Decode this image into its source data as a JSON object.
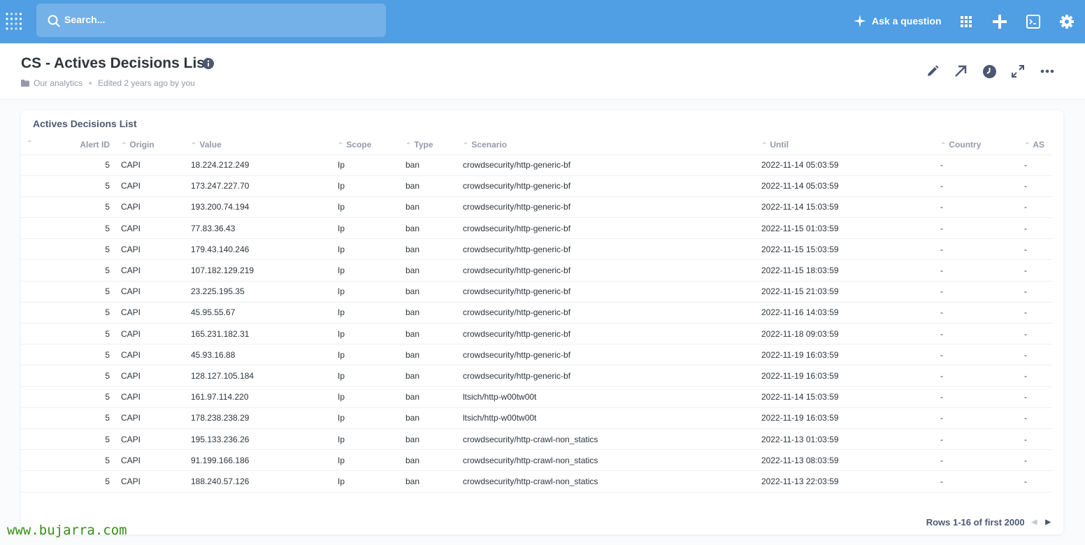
{
  "topbar": {
    "search_placeholder": "Search...",
    "ask_label": "Ask a question",
    "bg_color": "#509ee3",
    "icons": [
      "grid-icon",
      "plus-icon",
      "terminal-icon",
      "gear-icon"
    ]
  },
  "header": {
    "title": "CS - Actives Decisions List",
    "collection": "Our analytics",
    "edited": "Edited 2 years ago by you",
    "icons": [
      "pencil-icon",
      "arrow-up-right-icon",
      "clock-icon",
      "expand-icon",
      "more-icon"
    ]
  },
  "card": {
    "title": "Actives Decisions List",
    "columns": [
      "Alert ID",
      "Origin",
      "Value",
      "Scope",
      "Type",
      "Scenario",
      "Until",
      "Country",
      "AS"
    ],
    "rows": [
      [
        "5",
        "CAPI",
        "18.224.212.249",
        "Ip",
        "ban",
        "crowdsecurity/http-generic-bf",
        "2022-11-14 05:03:59",
        "-",
        "-"
      ],
      [
        "5",
        "CAPI",
        "173.247.227.70",
        "Ip",
        "ban",
        "crowdsecurity/http-generic-bf",
        "2022-11-14 05:03:59",
        "-",
        "-"
      ],
      [
        "5",
        "CAPI",
        "193.200.74.194",
        "Ip",
        "ban",
        "crowdsecurity/http-generic-bf",
        "2022-11-14 15:03:59",
        "-",
        "-"
      ],
      [
        "5",
        "CAPI",
        "77.83.36.43",
        "Ip",
        "ban",
        "crowdsecurity/http-generic-bf",
        "2022-11-15 01:03:59",
        "-",
        "-"
      ],
      [
        "5",
        "CAPI",
        "179.43.140.246",
        "Ip",
        "ban",
        "crowdsecurity/http-generic-bf",
        "2022-11-15 15:03:59",
        "-",
        "-"
      ],
      [
        "5",
        "CAPI",
        "107.182.129.219",
        "Ip",
        "ban",
        "crowdsecurity/http-generic-bf",
        "2022-11-15 18:03:59",
        "-",
        "-"
      ],
      [
        "5",
        "CAPI",
        "23.225.195.35",
        "Ip",
        "ban",
        "crowdsecurity/http-generic-bf",
        "2022-11-15 21:03:59",
        "-",
        "-"
      ],
      [
        "5",
        "CAPI",
        "45.95.55.67",
        "Ip",
        "ban",
        "crowdsecurity/http-generic-bf",
        "2022-11-16 14:03:59",
        "-",
        "-"
      ],
      [
        "5",
        "CAPI",
        "165.231.182.31",
        "Ip",
        "ban",
        "crowdsecurity/http-generic-bf",
        "2022-11-18 09:03:59",
        "-",
        "-"
      ],
      [
        "5",
        "CAPI",
        "45.93.16.88",
        "Ip",
        "ban",
        "crowdsecurity/http-generic-bf",
        "2022-11-19 16:03:59",
        "-",
        "-"
      ],
      [
        "5",
        "CAPI",
        "128.127.105.184",
        "Ip",
        "ban",
        "crowdsecurity/http-generic-bf",
        "2022-11-19 16:03:59",
        "-",
        "-"
      ],
      [
        "5",
        "CAPI",
        "161.97.114.220",
        "Ip",
        "ban",
        "ltsich/http-w00tw00t",
        "2022-11-14 15:03:59",
        "-",
        "-"
      ],
      [
        "5",
        "CAPI",
        "178.238.238.29",
        "Ip",
        "ban",
        "ltsich/http-w00tw00t",
        "2022-11-19 16:03:59",
        "-",
        "-"
      ],
      [
        "5",
        "CAPI",
        "195.133.236.26",
        "Ip",
        "ban",
        "crowdsecurity/http-crawl-non_statics",
        "2022-11-13 01:03:59",
        "-",
        "-"
      ],
      [
        "5",
        "CAPI",
        "91.199.166.186",
        "Ip",
        "ban",
        "crowdsecurity/http-crawl-non_statics",
        "2022-11-13 08:03:59",
        "-",
        "-"
      ],
      [
        "5",
        "CAPI",
        "188.240.57.126",
        "Ip",
        "ban",
        "crowdsecurity/http-crawl-non_statics",
        "2022-11-13 22:03:59",
        "-",
        "-"
      ]
    ],
    "pagination": "Rows 1-16 of first 2000"
  },
  "watermark": "www.bujarra.com"
}
